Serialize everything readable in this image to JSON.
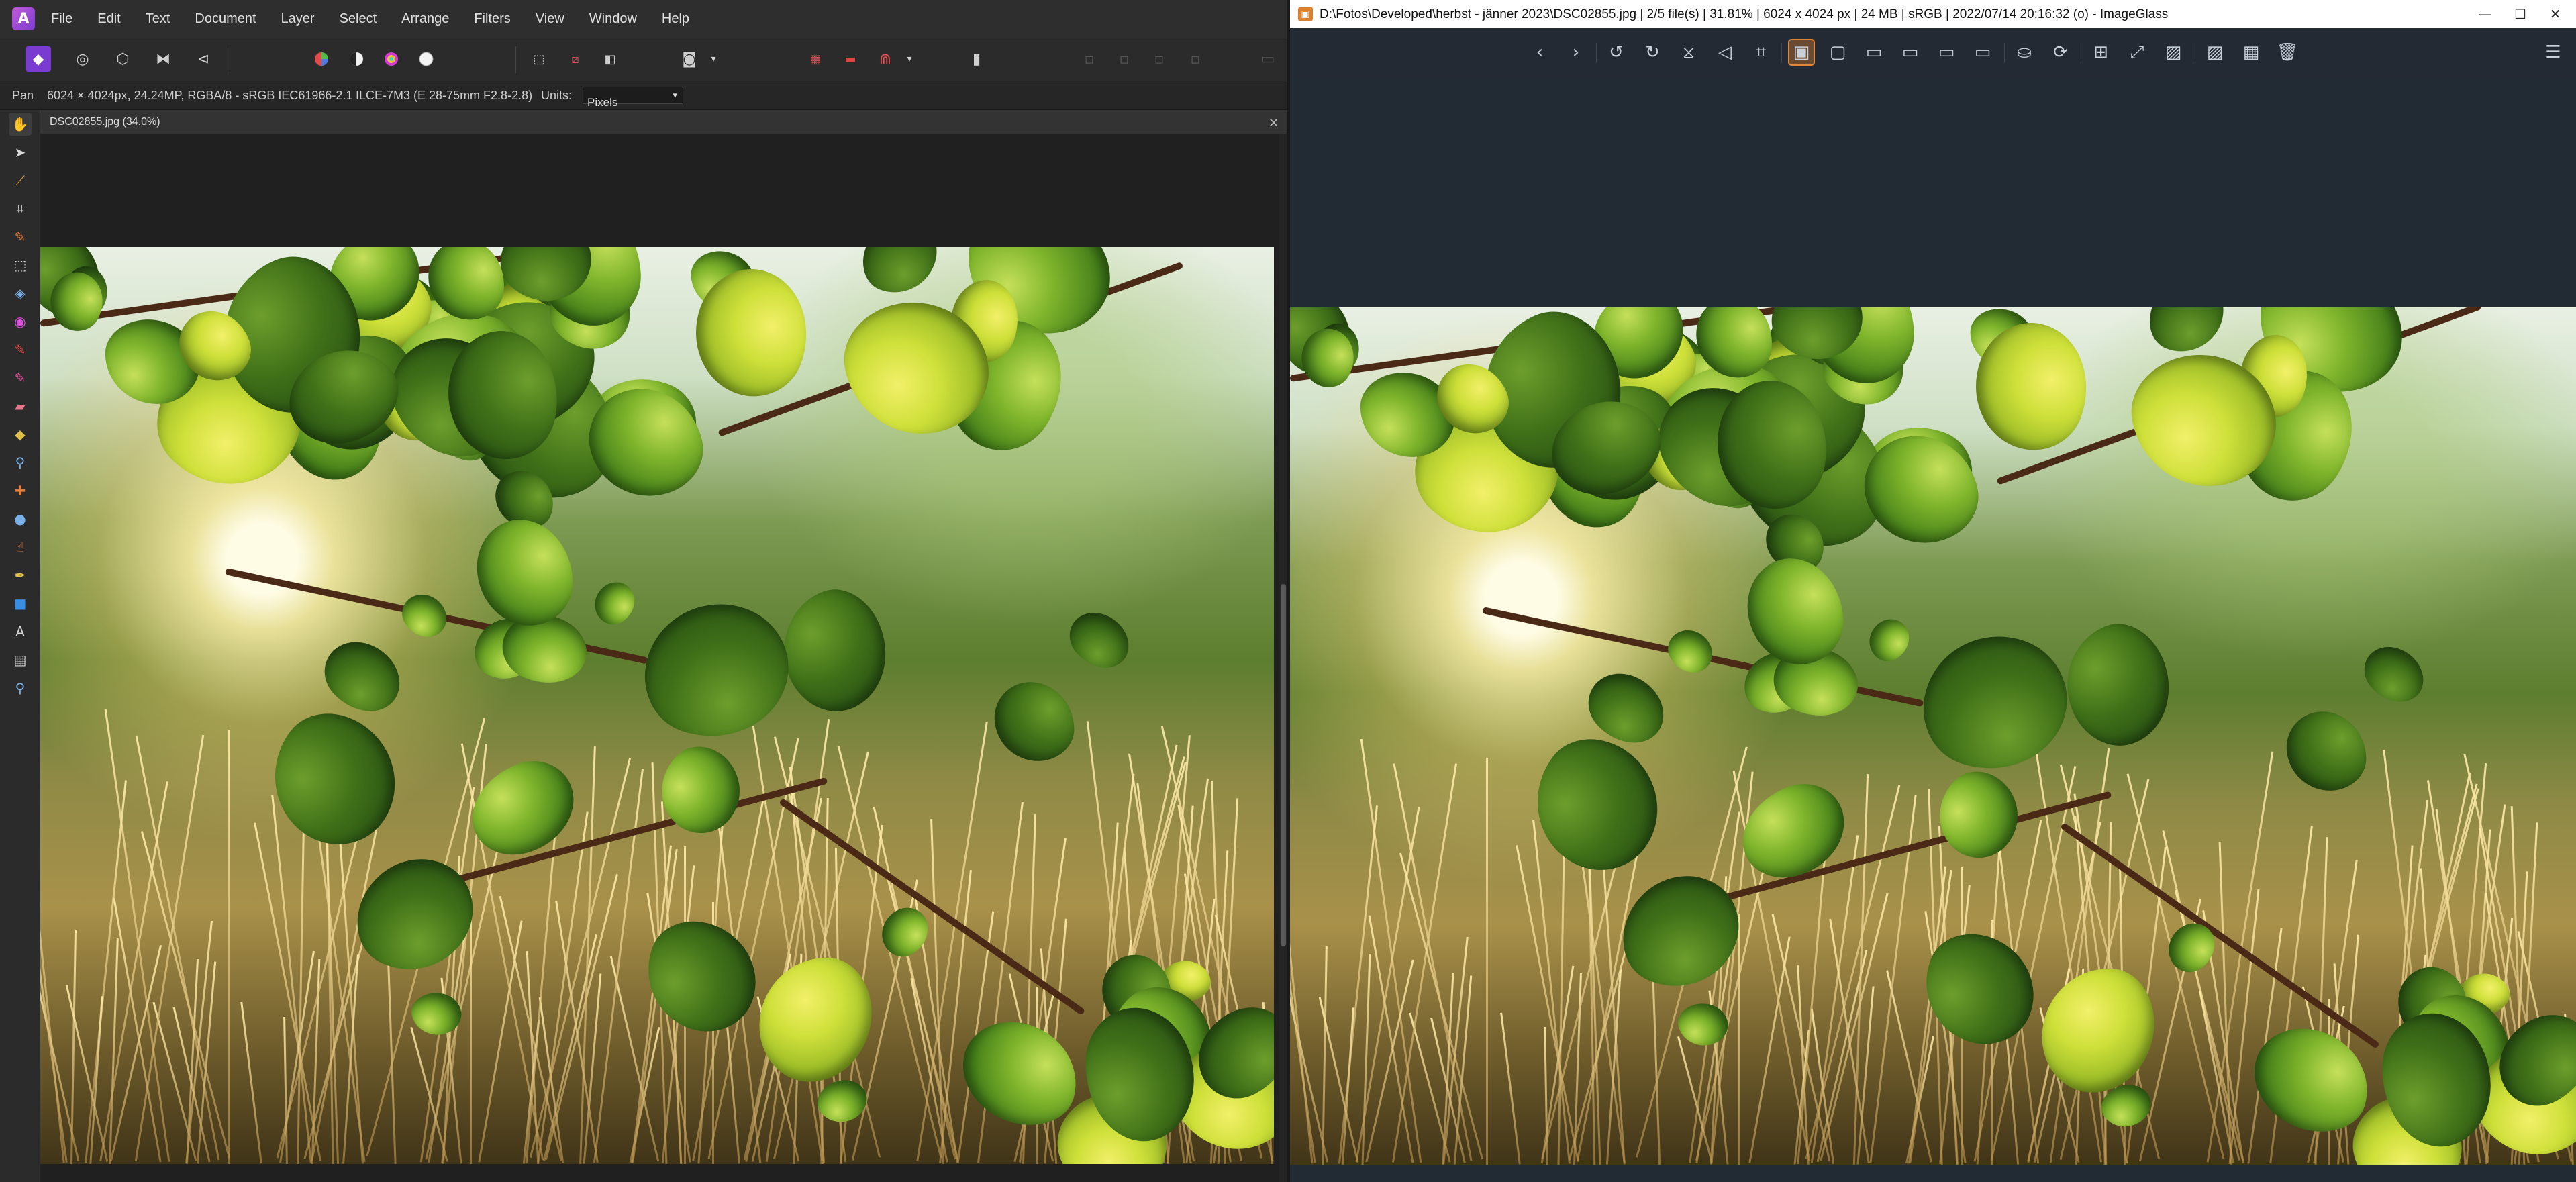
{
  "affinity": {
    "menu": [
      "File",
      "Edit",
      "Text",
      "Document",
      "Layer",
      "Select",
      "Arrange",
      "Filters",
      "View",
      "Window",
      "Help"
    ],
    "context": {
      "tool": "Pan",
      "doc_info": "6024 × 4024px, 24.24MP, RGBA/8 - sRGB IEC61966-2.1",
      "camera": "ILCE-7M3 (E 28-75mm F2.8-2.8)",
      "units_label": "Units:",
      "units_value": "Pixels"
    },
    "doc_tab": "DSC02855.jpg (34.0%)",
    "close_glyph": "×",
    "accent": "#9b4fd8"
  },
  "imageglass": {
    "title": "D:\\Fotos\\Developed\\herbst - jänner 2023\\DSC02855.jpg  |  2/5 file(s)  |  31.81%  |  6024 x 4024 px  |  24 MB  |  sRGB  |  2022/07/14 20:16:32 (o)  - ImageGlass",
    "window_controls": [
      "—",
      "☐",
      "✕"
    ],
    "accent": "#e0873a",
    "toolbar_icons": [
      "prev-icon",
      "next-icon",
      "rotate-left-icon",
      "rotate-right-icon",
      "flip-horizontal-icon",
      "flip-vertical-icon",
      "crop-icon",
      "auto-zoom-icon",
      "lock-zoom-icon",
      "scale-to-width-icon",
      "scale-to-height-icon",
      "scale-to-fit-icon",
      "scale-to-fill-icon",
      "slideshow-icon",
      "refresh-icon",
      "gallery-icon",
      "frameless-icon",
      "wallpaper-icon",
      "color-picker-icon",
      "thumbnail-icon",
      "delete-icon",
      "menu-icon"
    ]
  }
}
